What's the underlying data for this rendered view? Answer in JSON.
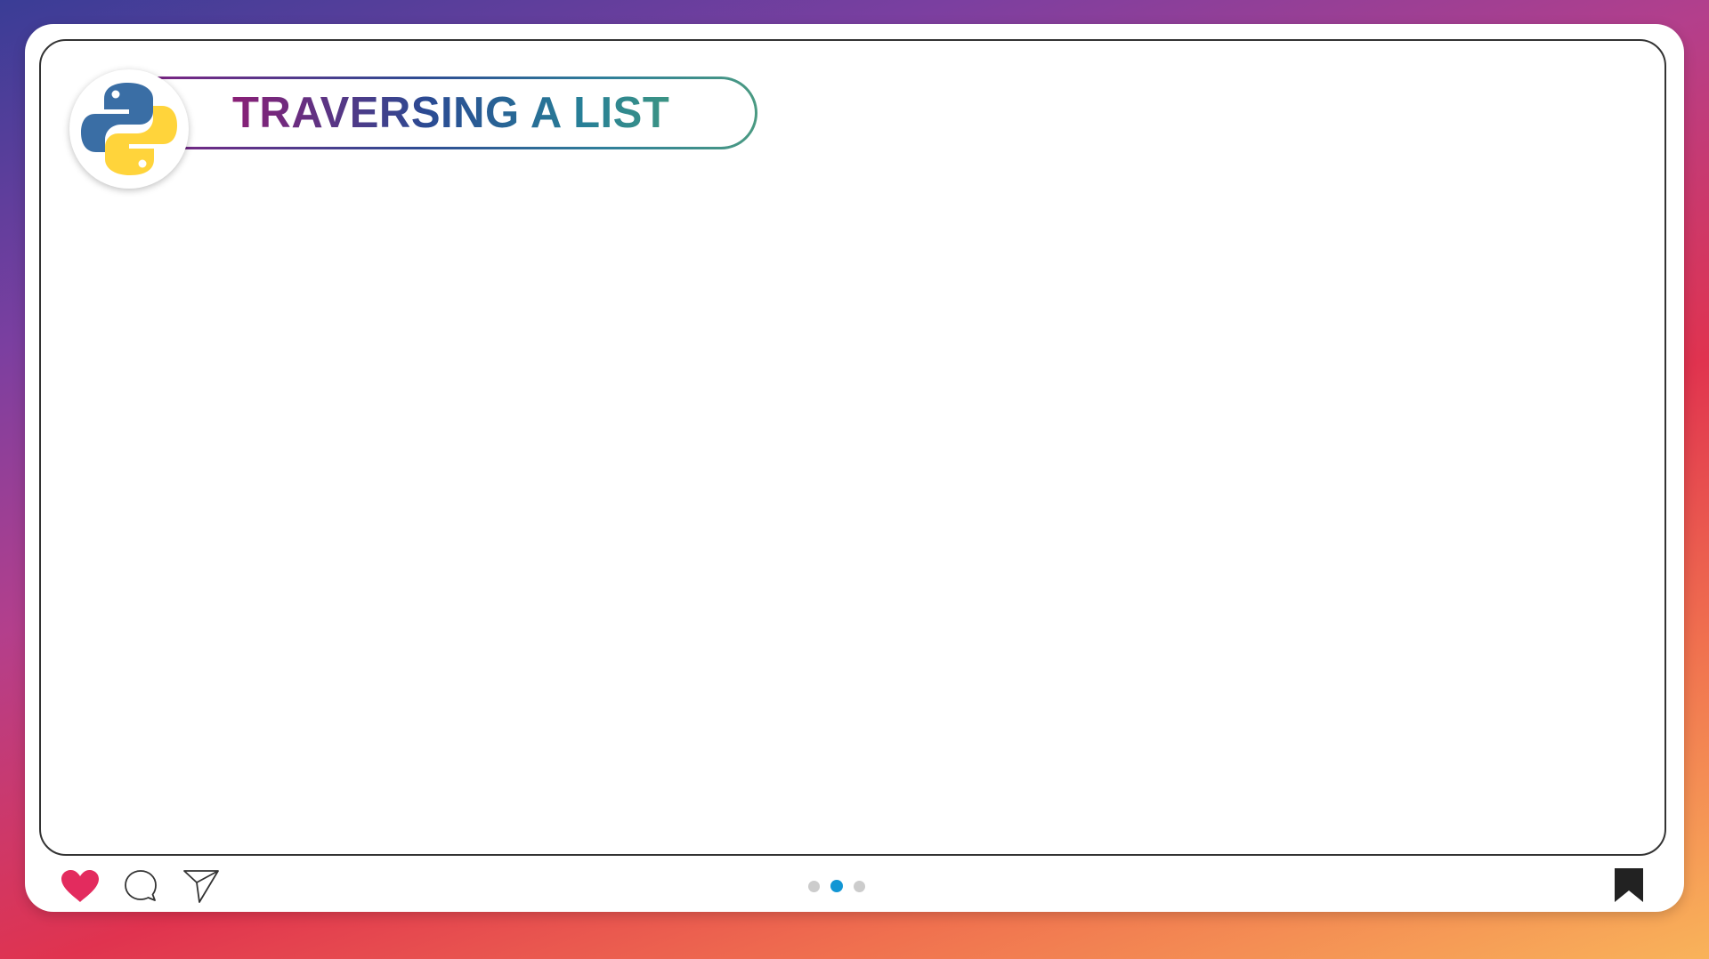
{
  "header": {
    "title": "TRAVERSING A LIST",
    "logo_icon": "python-logo-icon"
  },
  "footer": {
    "icons": {
      "like": "heart-icon",
      "comment": "comment-bubble-icon",
      "share": "paper-plane-icon",
      "save": "bookmark-icon"
    },
    "pagination": {
      "total": 3,
      "active_index": 1
    }
  },
  "colors": {
    "heart": "#e32b5e",
    "active_dot": "#1296d4",
    "inactive_dot": "#cccccc",
    "python_blue": "#3a6ea5",
    "python_yellow": "#ffd43b",
    "bookmark": "#222222"
  }
}
